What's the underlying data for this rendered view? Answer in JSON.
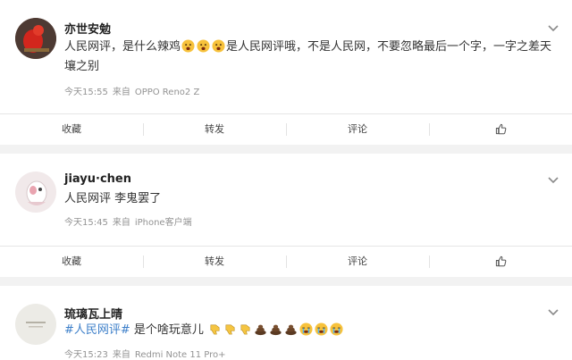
{
  "posts": [
    {
      "username": "亦世安勉",
      "text_prefix": "人民网评，是什么辣鸡",
      "emojis": [
        "scared-face",
        "scared-face",
        "scared-face"
      ],
      "text_suffix": "是人民网评哦，不是人民网，不要忽略最后一个字，一字之差天壤之别",
      "time": "今天15:55",
      "source_prefix": "来自",
      "source": "OPPO Reno2 Z"
    },
    {
      "username": "jiayu·chen",
      "text": "人民网评 李鬼罢了",
      "time": "今天15:45",
      "source_prefix": "来自",
      "source": "iPhone客户端"
    },
    {
      "username": "琉璃瓦上晴",
      "hashtag": "#人民网评#",
      "text_suffix": " 是个啥玩意儿",
      "emojis": [
        "thumbs-down",
        "thumbs-down",
        "thumbs-down",
        "poop",
        "poop",
        "poop",
        "crying-face",
        "crying-face",
        "crying-face"
      ],
      "time": "今天15:23",
      "source_prefix": "来自",
      "source": "Redmi Note 11 Pro+"
    }
  ],
  "actions": {
    "collect": "收藏",
    "repost": "转发",
    "comment": "评论",
    "like": "like-icon"
  },
  "colors": {
    "background": "#f2f2f2",
    "card": "#ffffff",
    "meta": "#939393",
    "hashtag": "#3d7fc9"
  }
}
